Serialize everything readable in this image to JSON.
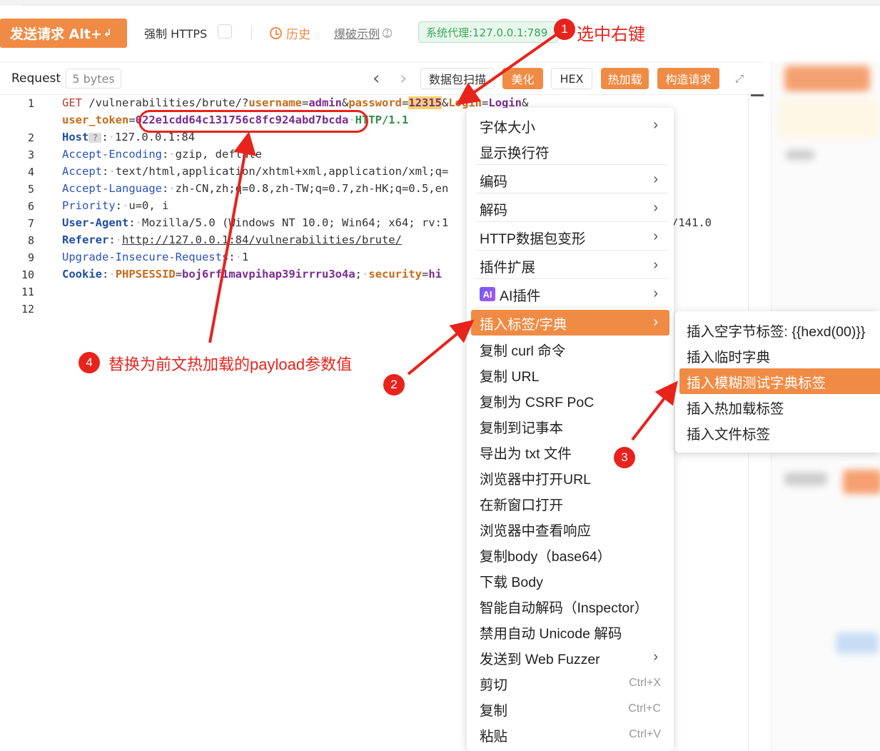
{
  "toolbar": {
    "send_label": "发送请求 Alt+",
    "send_enter_glyph": "↲",
    "force_https_label": "强制 HTTPS",
    "history_label": "历史",
    "burst_example_label": "爆破示例",
    "proxy_label": "系统代理:127.0.0.1:789"
  },
  "request_header": {
    "title": "Request",
    "size": "5 bytes",
    "prev_glyph": "‹",
    "next_glyph": "›",
    "packet_btn": "数据包扫描",
    "beautify_btn": "美化",
    "hex_btn": "HEX",
    "hotload_btn": "热加载",
    "build_btn": "构造请求",
    "expand_glyph": "⤢"
  },
  "editor": {
    "line_numbers": [
      "1",
      "2",
      "3",
      "4",
      "5",
      "6",
      "7",
      "8",
      "9",
      "10",
      "11",
      "12"
    ],
    "l1_method": "GET",
    "l1_path": "/vulnerabilities/brute/?",
    "l1_k1": "username",
    "l1_eq": "=",
    "l1_v1": "admin",
    "l1_amp": "&",
    "l1_k2": "password",
    "l1_v2": "12315",
    "l1_k3": "Login",
    "l1_v3": "Login",
    "l1b_k": "user_token",
    "l1b_v": "022e1cdd64c131756c8fc924abd7bcda",
    "l1b_proto": "HTTP/1.1",
    "l2_key": "Host",
    "l2_q": "?",
    "l2_val": "127.0.0.1:84",
    "l3_key": "Accept-Encoding",
    "l3_val": "gzip, deflate",
    "l4_key": "Accept",
    "l4_val": "text/html,application/xhtml+xml,application/xml;q=",
    "l5_key": "Accept-Language",
    "l5_val": "zh-CN,zh;q=0.8,zh-TW;q=0.7,zh-HK;q=0.5,en",
    "l6_key": "Priority",
    "l6_val": "u=0, i",
    "l7_key": "User-Agent",
    "l7_val": "Mozilla/5.0 (Windows NT 10.0; Win64; x64; rv:1",
    "l7_tail": "/141.0",
    "l8_key": "Referer",
    "l8_val": "http://127.0.0.1:84/vulnerabilities/brute/",
    "l9_key": "Upgrade-Insecure-Requests",
    "l9_val": "1",
    "l10_key": "Cookie",
    "l10_ck1": "PHPSESSID",
    "l10_cv1": "boj6rf1mavpihap39irrru3o4a",
    "l10_sep": ";",
    "l10_ck2": "security",
    "l10_cv2": "hi",
    "colon": ":"
  },
  "context_menu": {
    "chev": "›",
    "items": [
      {
        "label": "字体大小"
      },
      {
        "label": "显示换行符"
      },
      {
        "label": "编码"
      },
      {
        "label": "解码"
      },
      {
        "label": "HTTP数据包变形"
      },
      {
        "label": "插件扩展"
      },
      {
        "label": "AI插件",
        "badge": "AI"
      },
      {
        "label": "插入标签/字典"
      },
      {
        "label": "复制 curl 命令"
      },
      {
        "label": "复制 URL"
      },
      {
        "label": "复制为 CSRF PoC"
      },
      {
        "label": "复制到记事本"
      },
      {
        "label": "导出为 txt 文件"
      },
      {
        "label": "浏览器中打开URL"
      },
      {
        "label": "在新窗口打开"
      },
      {
        "label": "浏览器中查看响应"
      },
      {
        "label": "复制body（base64）"
      },
      {
        "label": "下载 Body"
      },
      {
        "label": "智能自动解码（Inspector）"
      },
      {
        "label": "禁用自动 Unicode 解码"
      },
      {
        "label": "发送到 Web Fuzzer"
      },
      {
        "label": "剪切",
        "shortcut": "Ctrl+X"
      },
      {
        "label": "复制",
        "shortcut": "Ctrl+C"
      },
      {
        "label": "粘贴",
        "shortcut": "Ctrl+V"
      }
    ]
  },
  "submenu": {
    "items": [
      {
        "label": "插入空字节标签: {{hexd(00)}}"
      },
      {
        "label": "插入临时字典"
      },
      {
        "label": "插入模糊测试字典标签"
      },
      {
        "label": "插入热加载标签"
      },
      {
        "label": "插入文件标签"
      }
    ]
  },
  "annotations": {
    "step1_num": "1",
    "step1_text": "选中右键",
    "step2_num": "2",
    "step3_num": "3",
    "step4_num": "4",
    "step4_text": "替换为前文热加载的payload参数值",
    "color": "#e8231c"
  },
  "colors": {
    "accent": "#f08b45",
    "proxy_green": "#3aa55b"
  }
}
